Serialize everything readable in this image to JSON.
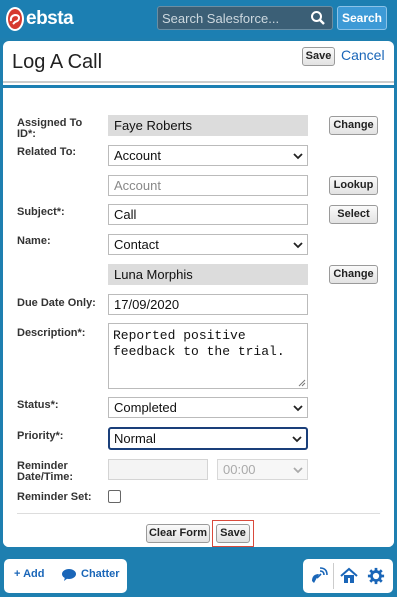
{
  "header": {
    "logo_text": "ebsta",
    "search_placeholder": "Search Salesforce...",
    "search_button": "Search"
  },
  "panel": {
    "title": "Log A Call",
    "save_label": "Save",
    "cancel_label": "Cancel"
  },
  "form": {
    "assigned_to_label": "Assigned To ID*:",
    "assigned_to_value": "Faye Roberts",
    "change_label": "Change",
    "related_to_label": "Related To:",
    "related_to_value": "Account",
    "account_placeholder": "Account",
    "lookup_label": "Lookup",
    "subject_label": "Subject*:",
    "subject_value": "Call",
    "select_label": "Select",
    "name_label": "Name:",
    "name_value": "Contact",
    "contact_value": "Luna Morphis",
    "change2_label": "Change",
    "due_date_label": "Due Date Only:",
    "due_date_value": "17/09/2020",
    "description_label": "Description*:",
    "description_value": "Reported positive feedback to the trial.",
    "status_label": "Status*:",
    "status_value": "Completed",
    "priority_label": "Priority*:",
    "priority_value": "Normal",
    "reminder_datetime_label": "Reminder Date/Time:",
    "reminder_time_value": "00:00",
    "reminder_set_label": "Reminder Set:",
    "clear_form_label": "Clear Form",
    "save_label": "Save"
  },
  "bottombar": {
    "add_label": "+ Add",
    "chatter_label": "Chatter"
  }
}
